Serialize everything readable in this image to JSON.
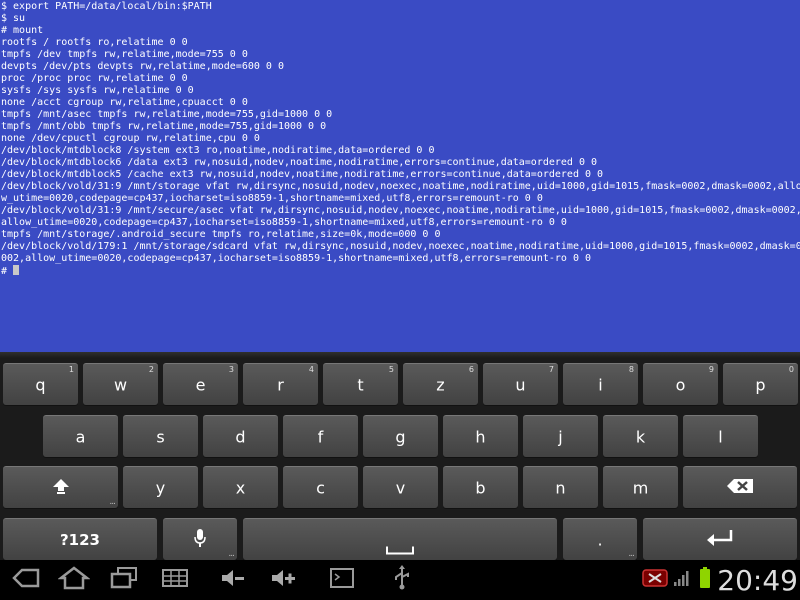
{
  "terminal": {
    "lines": [
      "$ export PATH=/data/local/bin:$PATH",
      "$ su",
      "# mount",
      "rootfs / rootfs ro,relatime 0 0",
      "tmpfs /dev tmpfs rw,relatime,mode=755 0 0",
      "devpts /dev/pts devpts rw,relatime,mode=600 0 0",
      "proc /proc proc rw,relatime 0 0",
      "sysfs /sys sysfs rw,relatime 0 0",
      "none /acct cgroup rw,relatime,cpuacct 0 0",
      "tmpfs /mnt/asec tmpfs rw,relatime,mode=755,gid=1000 0 0",
      "tmpfs /mnt/obb tmpfs rw,relatime,mode=755,gid=1000 0 0",
      "none /dev/cpuctl cgroup rw,relatime,cpu 0 0",
      "/dev/block/mtdblock8 /system ext3 ro,noatime,nodiratime,data=ordered 0 0",
      "/dev/block/mtdblock6 /data ext3 rw,nosuid,nodev,noatime,nodiratime,errors=continue,data=ordered 0 0",
      "/dev/block/mtdblock5 /cache ext3 rw,nosuid,nodev,noatime,nodiratime,errors=continue,data=ordered 0 0",
      "/dev/block/vold/31:9 /mnt/storage vfat rw,dirsync,nosuid,nodev,noexec,noatime,nodiratime,uid=1000,gid=1015,fmask=0002,dmask=0002,allo",
      "w_utime=0020,codepage=cp437,iocharset=iso8859-1,shortname=mixed,utf8,errors=remount-ro 0 0",
      "/dev/block/vold/31:9 /mnt/secure/asec vfat rw,dirsync,nosuid,nodev,noexec,noatime,nodiratime,uid=1000,gid=1015,fmask=0002,dmask=0002,",
      "allow_utime=0020,codepage=cp437,iocharset=iso8859-1,shortname=mixed,utf8,errors=remount-ro 0 0",
      "tmpfs /mnt/storage/.android_secure tmpfs ro,relatime,size=0k,mode=000 0 0",
      "/dev/block/vold/179:1 /mnt/storage/sdcard vfat rw,dirsync,nosuid,nodev,noexec,noatime,nodiratime,uid=1000,gid=1015,fmask=0002,dmask=0",
      "002,allow_utime=0020,codepage=cp437,iocharset=iso8859-1,shortname=mixed,utf8,errors=remount-ro 0 0"
    ],
    "prompt": "#"
  },
  "keyboard": {
    "row1": [
      {
        "label": "q",
        "hint": "1"
      },
      {
        "label": "w",
        "hint": "2"
      },
      {
        "label": "e",
        "hint": "3"
      },
      {
        "label": "r",
        "hint": "4"
      },
      {
        "label": "t",
        "hint": "5"
      },
      {
        "label": "z",
        "hint": "6"
      },
      {
        "label": "u",
        "hint": "7"
      },
      {
        "label": "i",
        "hint": "8"
      },
      {
        "label": "o",
        "hint": "9"
      },
      {
        "label": "p",
        "hint": "0"
      }
    ],
    "row2": [
      "a",
      "s",
      "d",
      "f",
      "g",
      "h",
      "j",
      "k",
      "l"
    ],
    "row3": [
      "y",
      "x",
      "c",
      "v",
      "b",
      "n",
      "m"
    ],
    "symbols_label": "?123",
    "period_label": ".",
    "dots": "..."
  },
  "status": {
    "clock": "20:49"
  },
  "colors": {
    "terminal_bg": "#3a4bc4",
    "terminal_fg": "#ffffff",
    "battery": "#8fd400"
  },
  "icons": {
    "navbar": [
      "back-icon",
      "home-icon",
      "recent-apps-icon",
      "screenshot-icon",
      "volume-down-icon",
      "volume-up-icon",
      "terminal-notification-icon",
      "usb-icon"
    ],
    "status": [
      "debug-notification-icon",
      "signal-icon",
      "battery-icon"
    ]
  }
}
